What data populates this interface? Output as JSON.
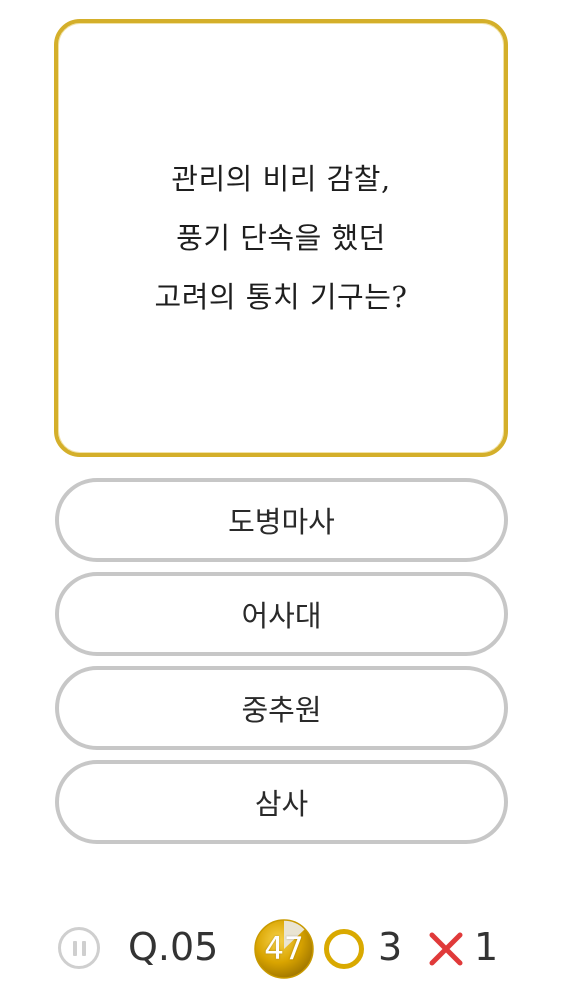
{
  "question": {
    "lines": [
      "관리의 비리 감찰,",
      "풍기 단속을 했던",
      "고려의 통치 기구는?"
    ]
  },
  "answers": [
    {
      "label": "도병마사"
    },
    {
      "label": "어사대"
    },
    {
      "label": "중추원"
    },
    {
      "label": "삼사"
    }
  ],
  "status": {
    "question_number": "Q.05",
    "timer": "47",
    "correct_count": "3",
    "wrong_count": "1"
  },
  "icons": {
    "pause": "pause-icon",
    "timer": "timer-icon",
    "correct": "circle-o-icon",
    "wrong": "cross-x-icon"
  },
  "colors": {
    "card_border": "#d4af2a",
    "answer_border": "#c7c7c7",
    "correct": "#d9a900",
    "wrong": "#e03a3a"
  }
}
